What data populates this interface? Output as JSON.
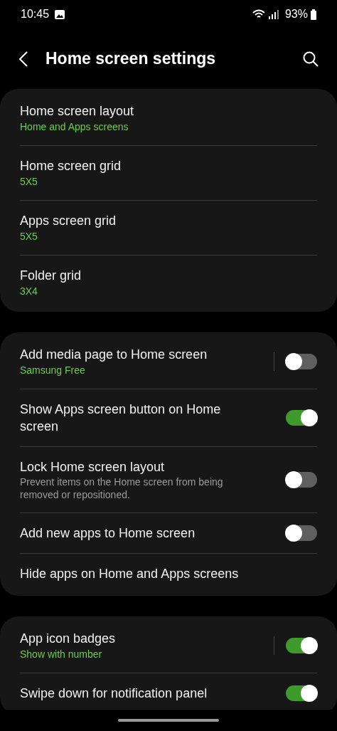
{
  "status_bar": {
    "time": "10:45",
    "battery": "93%"
  },
  "header": {
    "title": "Home screen settings"
  },
  "sections": [
    {
      "items": [
        {
          "kind": "nav",
          "title": "Home screen layout",
          "summary": "Home and Apps screens"
        },
        {
          "kind": "nav",
          "title": "Home screen grid",
          "summary": "5X5"
        },
        {
          "kind": "nav",
          "title": "Apps screen grid",
          "summary": "5X5"
        },
        {
          "kind": "nav",
          "title": "Folder grid",
          "summary": "3X4"
        }
      ]
    },
    {
      "items": [
        {
          "kind": "toggle",
          "title": "Add media page to Home screen",
          "summary": "Samsung Free",
          "split": true,
          "on": false
        },
        {
          "kind": "toggle",
          "title": "Show Apps screen button on Home screen",
          "split": false,
          "on": true
        },
        {
          "kind": "toggle",
          "title": "Lock Home screen layout",
          "description": "Prevent items on the Home screen from being removed or repositioned.",
          "split": false,
          "on": false
        },
        {
          "kind": "toggle",
          "title": "Add new apps to Home screen",
          "split": false,
          "on": false
        },
        {
          "kind": "nav",
          "title": "Hide apps on Home and Apps screens"
        }
      ]
    },
    {
      "items": [
        {
          "kind": "toggle",
          "title": "App icon badges",
          "summary": "Show with number",
          "split": true,
          "on": true
        },
        {
          "kind": "toggle",
          "title": "Swipe down for notification panel",
          "split": false,
          "on": true
        }
      ]
    }
  ]
}
